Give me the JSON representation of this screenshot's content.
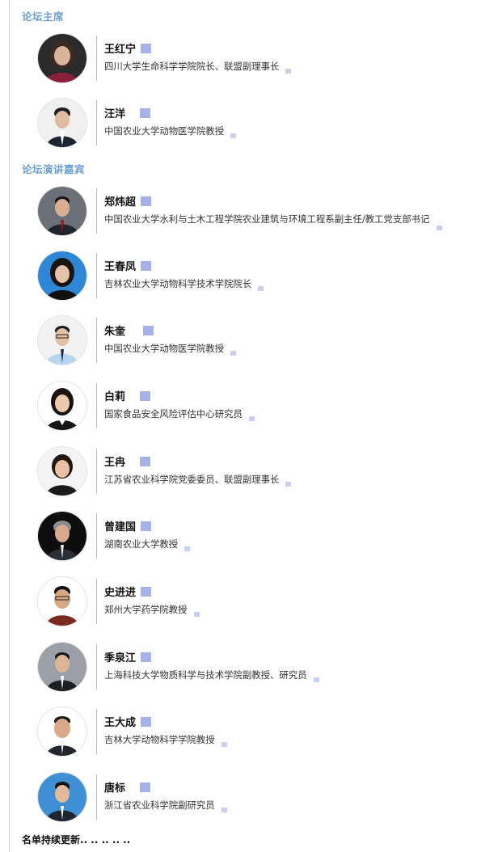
{
  "sections": {
    "chairs_title": "论坛主席",
    "speakers_title": "论坛演讲嘉宾"
  },
  "chairs": [
    {
      "name": "王红宁",
      "title": "四川大学生命科学学院院长、联盟副理事长"
    },
    {
      "name": "汪洋",
      "title": "中国农业大学动物医学院教授"
    }
  ],
  "speakers": [
    {
      "name": "郑炜超",
      "title": "中国农业大学水利与土木工程学院农业建筑与环境工程系副主任/教工党支部书记"
    },
    {
      "name": "王春凤",
      "title": "吉林农业大学动物科学技术学院院长"
    },
    {
      "name": "朱奎",
      "title": "中国农业大学动物医学院教授"
    },
    {
      "name": "白莉",
      "title": "国家食品安全风险评估中心研究员"
    },
    {
      "name": "王冉",
      "title": "江苏省农业科学院党委委员、联盟副理事长"
    },
    {
      "name": "曾建国",
      "title": "湖南农业大学教授"
    },
    {
      "name": "史进进",
      "title": "郑州大学药学院教授"
    },
    {
      "name": "季泉江",
      "title": "上海科技大学物质科学与技术学院副教授、研究员"
    },
    {
      "name": "王大成",
      "title": "吉林大学动物科学学院教授"
    },
    {
      "name": "唐标",
      "title": "浙江省农业科学院副研究员"
    }
  ],
  "footer": "名单持续更新.. .. .. .. .."
}
